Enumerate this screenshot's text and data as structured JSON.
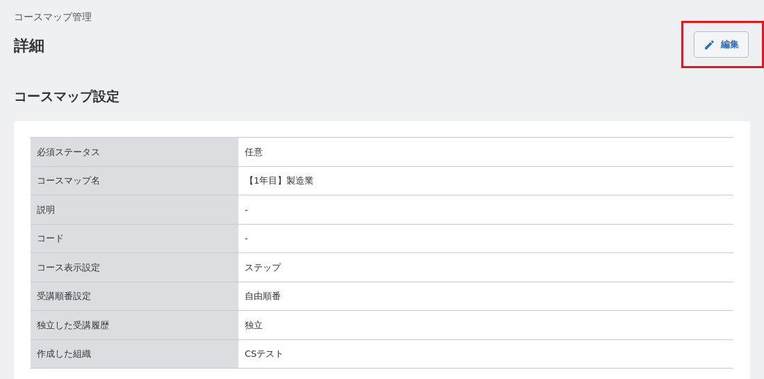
{
  "breadcrumb": "コースマップ管理",
  "page_title": "詳細",
  "edit_button": {
    "label": "編集"
  },
  "section_title": "コースマップ設定",
  "details": [
    {
      "label": "必須ステータス",
      "value": "任意"
    },
    {
      "label": "コースマップ名",
      "value": "【1年目】製造業"
    },
    {
      "label": "説明",
      "value": "-"
    },
    {
      "label": "コード",
      "value": "-"
    },
    {
      "label": "コース表示設定",
      "value": "ステップ"
    },
    {
      "label": "受講順番設定",
      "value": "自由順番"
    },
    {
      "label": "独立した受講履歴",
      "value": "独立"
    },
    {
      "label": "作成した組織",
      "value": "CSテスト"
    }
  ]
}
